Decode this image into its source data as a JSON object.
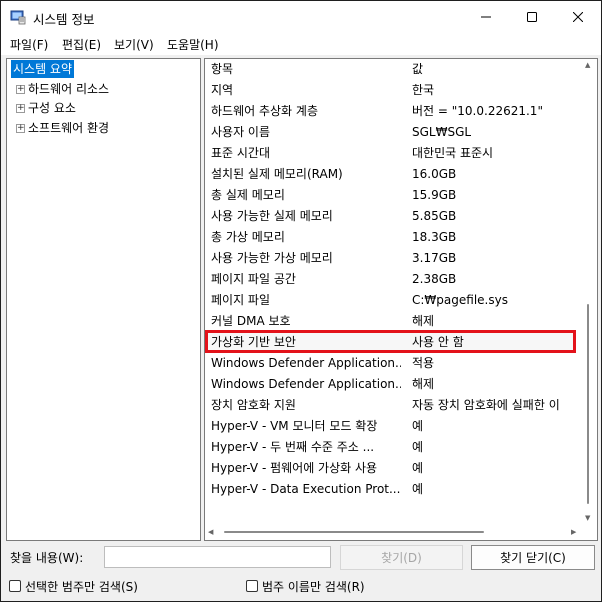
{
  "window": {
    "title": "시스템 정보"
  },
  "menu": [
    {
      "label": "파일(F)"
    },
    {
      "label": "편집(E)"
    },
    {
      "label": "보기(V)"
    },
    {
      "label": "도움말(H)"
    }
  ],
  "tree": {
    "root": "시스템 요약",
    "children": [
      "하드웨어 리소스",
      "구성 요소",
      "소프트웨어 환경"
    ]
  },
  "table": {
    "headers": {
      "item": "항목",
      "value": "값"
    },
    "rows": [
      {
        "item": "지역",
        "value": "한국"
      },
      {
        "item": "하드웨어 추상화 계층",
        "value": "버전 = \"10.0.22621.1\""
      },
      {
        "item": "사용자 이름",
        "value": "SGL₩SGL"
      },
      {
        "item": "표준 시간대",
        "value": "대한민국 표준시"
      },
      {
        "item": "설치된 실제 메모리(RAM)",
        "value": "16.0GB"
      },
      {
        "item": "총 실제 메모리",
        "value": "15.9GB"
      },
      {
        "item": "사용 가능한 실제 메모리",
        "value": "5.85GB"
      },
      {
        "item": "총 가상 메모리",
        "value": "18.3GB"
      },
      {
        "item": "사용 가능한 가상 메모리",
        "value": "3.17GB"
      },
      {
        "item": "페이지 파일 공간",
        "value": "2.38GB"
      },
      {
        "item": "페이지 파일",
        "value": "C:₩pagefile.sys"
      },
      {
        "item": "커널 DMA 보호",
        "value": "해제"
      },
      {
        "item": "가상화 기반 보안",
        "value": "사용 안 함"
      },
      {
        "item": "Windows Defender Application...",
        "value": "적용"
      },
      {
        "item": "Windows Defender Application...",
        "value": "해제"
      },
      {
        "item": "장치 암호화 지원",
        "value": "자동 장치 암호화에 실패한 이"
      },
      {
        "item": "Hyper-V - VM 모니터 모드 확장",
        "value": "예"
      },
      {
        "item": "Hyper-V - 두 번째 수준 주소 ...",
        "value": "예"
      },
      {
        "item": "Hyper-V - 펌웨어에 가상화 사용",
        "value": "예"
      },
      {
        "item": "Hyper-V - Data Execution Prot...",
        "value": "예"
      }
    ]
  },
  "find": {
    "label": "찾을 내용(W):",
    "value": "",
    "find_button": "찾기(D)",
    "close_button": "찾기 닫기(C)",
    "check_selected": "선택한 범주만 검색(S)",
    "check_names": "범주 이름만 검색(R)"
  },
  "colors": {
    "highlight": "#e3121a",
    "selection": "#0078d7"
  }
}
